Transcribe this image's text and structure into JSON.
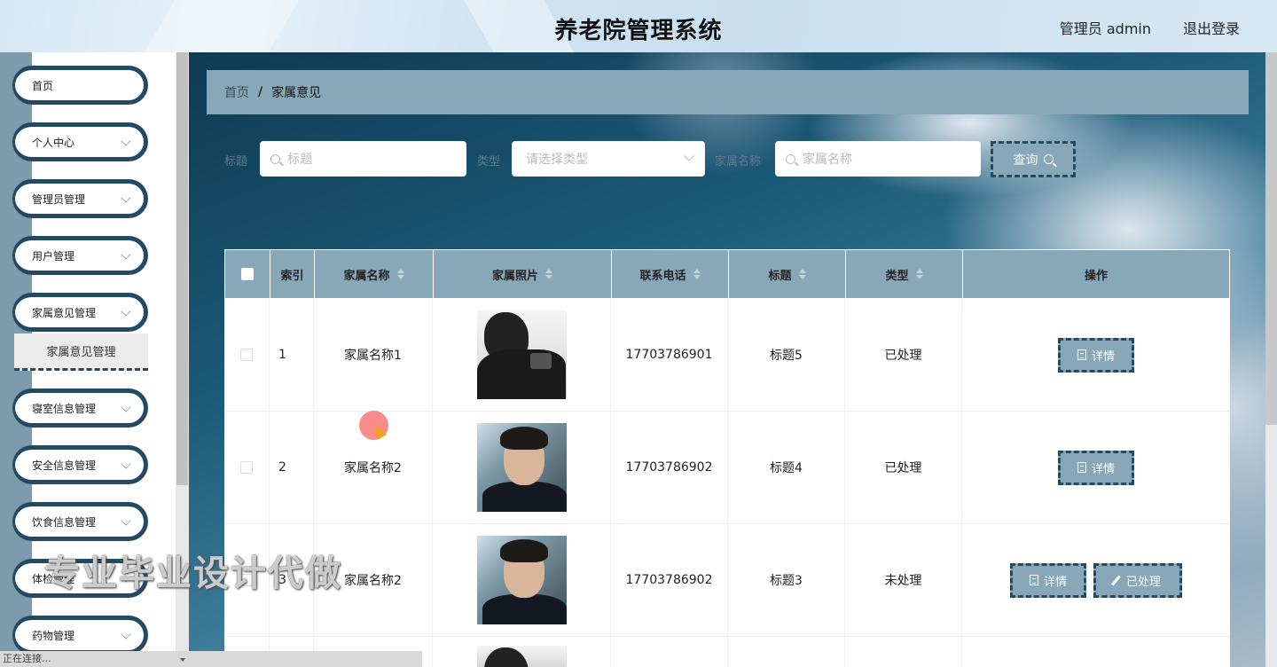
{
  "header": {
    "title": "养老院管理系统",
    "admin_label": "管理员 admin",
    "logout": "退出登录"
  },
  "sidebar": {
    "items": [
      {
        "label": "首页",
        "has_arrow": false
      },
      {
        "label": "个人中心",
        "has_arrow": true
      },
      {
        "label": "管理员管理",
        "has_arrow": true
      },
      {
        "label": "用户管理",
        "has_arrow": true
      },
      {
        "label": "家属意见管理",
        "has_arrow": true
      },
      {
        "label": "寝室信息管理",
        "has_arrow": true
      },
      {
        "label": "安全信息管理",
        "has_arrow": true
      },
      {
        "label": "饮食信息管理",
        "has_arrow": true
      },
      {
        "label": "体检管理",
        "has_arrow": true
      },
      {
        "label": "药物管理",
        "has_arrow": true
      }
    ],
    "subitem": "家属意见管理"
  },
  "breadcrumb": {
    "home": "首页",
    "separator": "/",
    "current": "家属意见"
  },
  "search": {
    "title_label": "标题",
    "title_placeholder": "标题",
    "type_label": "类型",
    "type_placeholder": "请选择类型",
    "name_label": "家属名称",
    "name_placeholder": "家属名称",
    "query_button": "查询"
  },
  "table": {
    "headers": [
      "索引",
      "家属名称",
      "家属照片",
      "联系电话",
      "标题",
      "类型",
      "操作"
    ],
    "rows": [
      {
        "index": "1",
        "name": "家属名称1",
        "photo": "bw",
        "phone": "17703786901",
        "title": "标题5",
        "type": "已处理",
        "actions": [
          "详情"
        ]
      },
      {
        "index": "2",
        "name": "家属名称2",
        "photo": "color",
        "phone": "17703786902",
        "title": "标题4",
        "type": "已处理",
        "actions": [
          "详情"
        ]
      },
      {
        "index": "3",
        "name": "家属名称2",
        "photo": "color",
        "phone": "17703786902",
        "title": "标题3",
        "type": "未处理",
        "actions": [
          "详情",
          "已处理"
        ]
      }
    ]
  },
  "watermark": "专业毕业设计代做",
  "status_text": "正在连接...",
  "colors": {
    "accent": "#88a8ba",
    "border_dark": "#244a62"
  }
}
